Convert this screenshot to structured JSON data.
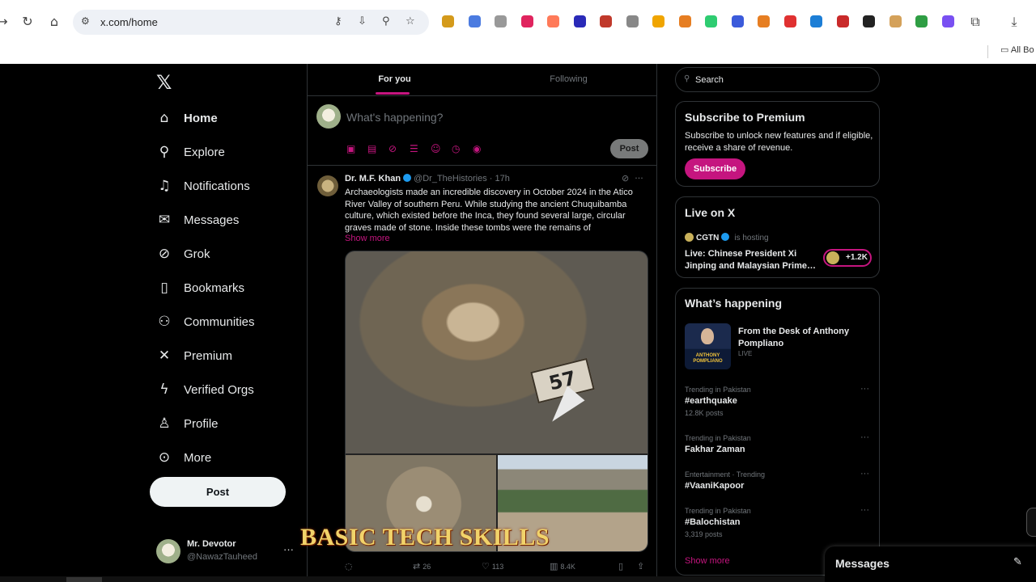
{
  "browser": {
    "url": "x.com/home",
    "bookmarks_label": "All Bo",
    "extensions": [
      "#d49a1b",
      "#4b7be0",
      "#999999",
      "#e0245e",
      "#ff7a59",
      "#2a2ab8",
      "#c0392b",
      "#888888",
      "#f0a500",
      "#e67e22",
      "#2ecc71",
      "#3b5bdb",
      "#e67e22",
      "#e03131",
      "#1c7ed6",
      "#c92a2a",
      "#222222",
      "#d4a15a",
      "#2f9e44",
      "#7950f2"
    ]
  },
  "nav": {
    "items": [
      {
        "label": "Home",
        "icon": "home-icon",
        "glyph": "⌂"
      },
      {
        "label": "Explore",
        "icon": "search-icon",
        "glyph": "⚲"
      },
      {
        "label": "Notifications",
        "icon": "bell-icon",
        "glyph": "♫"
      },
      {
        "label": "Messages",
        "icon": "mail-icon",
        "glyph": "✉"
      },
      {
        "label": "Grok",
        "icon": "grok-icon",
        "glyph": "⊘"
      },
      {
        "label": "Bookmarks",
        "icon": "bookmark-icon",
        "glyph": "▯"
      },
      {
        "label": "Communities",
        "icon": "communities-icon",
        "glyph": "⚇"
      },
      {
        "label": "Premium",
        "icon": "x-premium-icon",
        "glyph": "✕"
      },
      {
        "label": "Verified Orgs",
        "icon": "lightning-icon",
        "glyph": "ϟ"
      },
      {
        "label": "Profile",
        "icon": "person-icon",
        "glyph": "♙"
      },
      {
        "label": "More",
        "icon": "more-circle-icon",
        "glyph": "⊙"
      }
    ],
    "post_label": "Post",
    "profile": {
      "name": "Mr. Devotor",
      "handle": "@NawazTauheed"
    }
  },
  "feed": {
    "tabs": [
      "For you",
      "Following"
    ],
    "composer_placeholder": "What's happening?",
    "composer_post": "Post",
    "tweet": {
      "name": "Dr. M.F. Khan",
      "handle": "@Dr_TheHistories",
      "time": "· 17h",
      "text": "Archaeologists made an incredible discovery in October 2024 in the Atico River Valley of southern Peru. While studying the ancient Chuquibamba culture, which existed before the Inca, they found several large, circular graves made of stone. Inside these tombs were the remains of",
      "show_more": "Show more",
      "tag_number": "57",
      "retweets": "26",
      "likes": "113",
      "views": "8.4K"
    }
  },
  "sidebar": {
    "search_placeholder": "Search",
    "premium": {
      "title": "Subscribe to Premium",
      "desc": "Subscribe to unlock new features and if eligible, receive a share of revenue.",
      "button": "Subscribe"
    },
    "live": {
      "title": "Live on X",
      "host": "CGTN",
      "hosting": "is hosting",
      "event": "Live: Chinese President Xi Jinping and Malaysian Prime…",
      "listeners": "+1.2K"
    },
    "happening": {
      "title": "What’s happening",
      "feature_title": "From the Desk of Anthony Pompliano",
      "feature_sub": "LIVE",
      "feature_img_text": "ANTHONY POMPLIANO",
      "trends": [
        {
          "context": "Trending in Pakistan",
          "name": "#earthquake",
          "count": "12.8K posts"
        },
        {
          "context": "Trending in Pakistan",
          "name": "Fakhar Zaman",
          "count": ""
        },
        {
          "context": "Entertainment · Trending",
          "name": "#VaaniKapoor",
          "count": ""
        },
        {
          "context": "Trending in Pakistan",
          "name": "#Balochistan",
          "count": "3,319 posts"
        }
      ],
      "show_more": "Show more"
    }
  },
  "messages_dock": {
    "label": "Messages"
  },
  "overlay_caption": "BASIC TECH SKILLS",
  "colors": {
    "accent": "#c5157f",
    "verified": "#1d9bf0",
    "background": "#000000",
    "border": "#2f3336"
  }
}
